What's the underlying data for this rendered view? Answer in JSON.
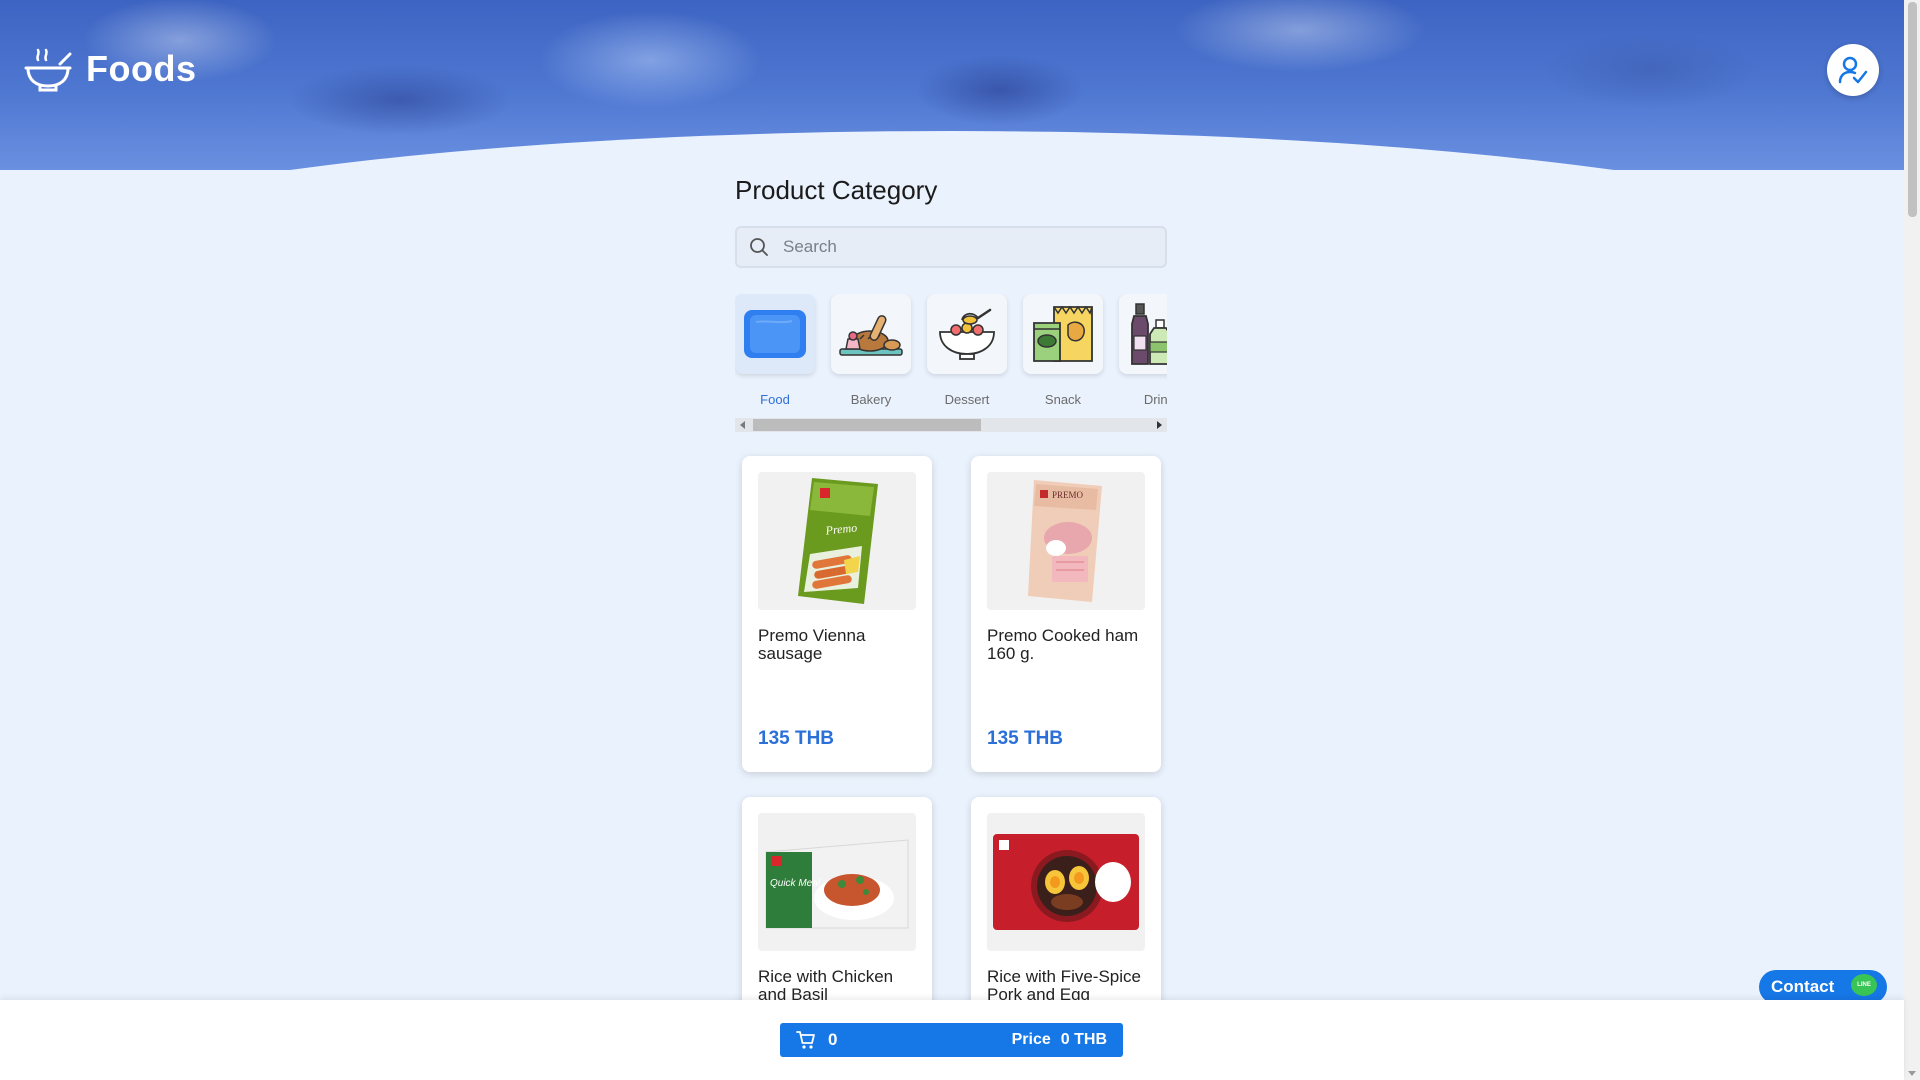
{
  "header": {
    "brand": "Foods",
    "brand_icon": "bowl-icon",
    "user_icon": "user-check-icon"
  },
  "main": {
    "title": "Product Category",
    "search_placeholder": "Search",
    "categories": [
      {
        "label": "Food",
        "icon": "food-tray-icon",
        "active": true
      },
      {
        "label": "Bakery",
        "icon": "bakery-icon",
        "active": false
      },
      {
        "label": "Dessert",
        "icon": "dessert-icon",
        "active": false
      },
      {
        "label": "Snack",
        "icon": "snack-icon",
        "active": false
      },
      {
        "label": "Drink",
        "icon": "drink-icon",
        "active": false
      }
    ],
    "products": [
      {
        "name": "Premo Vienna sausage",
        "price": "135 THB"
      },
      {
        "name": "Premo Cooked ham 160 g.",
        "price": "135 THB"
      },
      {
        "name": "Rice with Chicken and Basil",
        "price": ""
      },
      {
        "name": "Rice with Five-Spice Pork and Egg",
        "price": ""
      }
    ]
  },
  "cart": {
    "count": "0",
    "price_label": "Price",
    "price_value": "0 THB"
  },
  "contact": {
    "label": "Contact",
    "badge": "LINE"
  },
  "colors": {
    "accent": "#1677e6",
    "price": "#2b6fd9",
    "line_green": "#39c456"
  }
}
